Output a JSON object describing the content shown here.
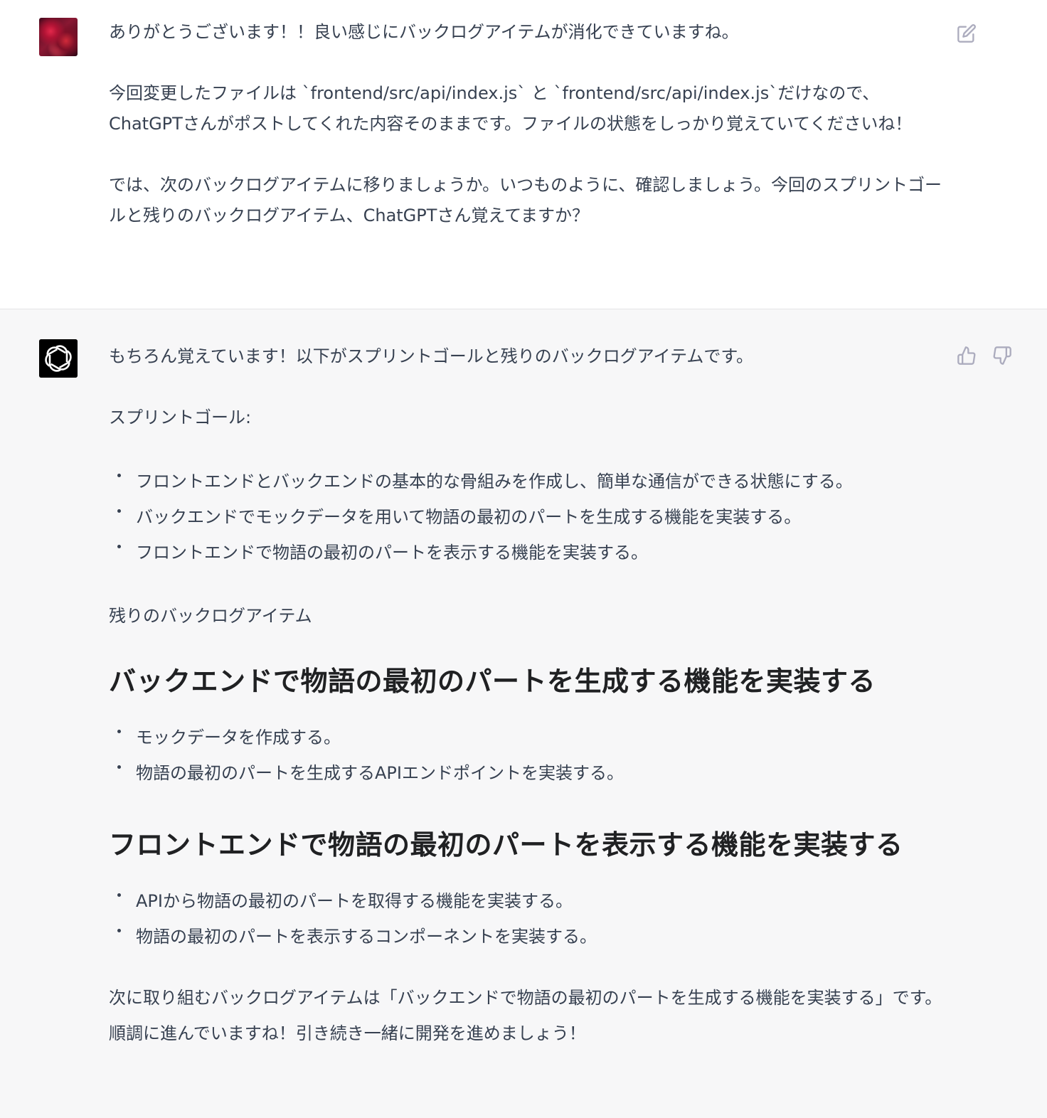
{
  "user_turn": {
    "avatar": "user-photo",
    "edit_icon": "edit-icon",
    "paragraphs": [
      "ありがとうございます！！良い感じにバックログアイテムが消化できていますね。",
      "今回変更したファイルは `frontend/src/api/index.js` と `frontend/src/api/index.js`だけなので、ChatGPTさんがポストしてくれた内容そのままです。ファイルの状態をしっかり覚えていてくださいね！",
      "では、次のバックログアイテムに移りましょうか。いつものように、確認しましょう。今回のスプリントゴールと残りのバックログアイテム、ChatGPTさん覚えてますか？"
    ]
  },
  "assistant_turn": {
    "avatar": "openai-logo-icon",
    "thumbs_up_icon": "thumbs-up-icon",
    "thumbs_down_icon": "thumbs-down-icon",
    "intro": "もちろん覚えています！以下がスプリントゴールと残りのバックログアイテムです。",
    "sprint_goal_label": "スプリントゴール:",
    "sprint_goals": [
      "フロントエンドとバックエンドの基本的な骨組みを作成し、簡単な通信ができる状態にする。",
      "バックエンドでモックデータを用いて物語の最初のパートを生成する機能を実装する。",
      "フロントエンドで物語の最初のパートを表示する機能を実装する。"
    ],
    "backlog_label": "残りのバックログアイテム",
    "sections": [
      {
        "heading": "バックエンドで物語の最初のパートを生成する機能を実装する",
        "items": [
          "モックデータを作成する。",
          "物語の最初のパートを生成するAPIエンドポイントを実装する。"
        ]
      },
      {
        "heading": "フロントエンドで物語の最初のパートを表示する機能を実装する",
        "items": [
          "APIから物語の最初のパートを取得する機能を実装する。",
          "物語の最初のパートを表示するコンポーネントを実装する。"
        ]
      }
    ],
    "closing": "次に取り組むバックログアイテムは「バックエンドで物語の最初のパートを生成する機能を実装する」です。順調に進んでいますね！引き続き一緒に開発を進めましょう！"
  },
  "colors": {
    "text": "#374151",
    "heading": "#202123",
    "assistant_bg": "#f7f7f8",
    "icon": "#acacbe"
  }
}
